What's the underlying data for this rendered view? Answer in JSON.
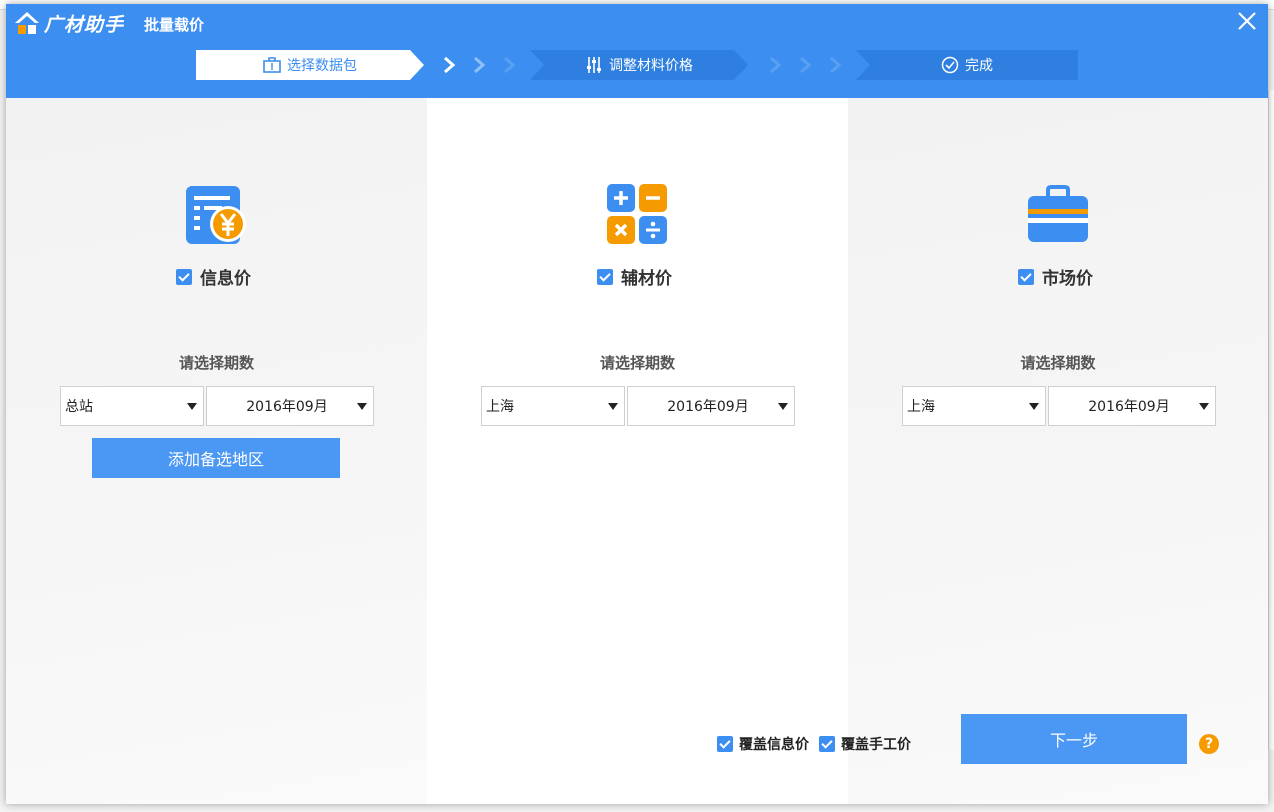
{
  "window": {
    "logo_text": "广材助手",
    "title": "批量载价"
  },
  "steps": [
    {
      "label": "选择数据包",
      "icon": "briefcase-icon",
      "active": true
    },
    {
      "label": "调整材料价格",
      "icon": "sliders-icon",
      "active": false
    },
    {
      "label": "完成",
      "icon": "check-circle-icon",
      "active": false
    }
  ],
  "columns": [
    {
      "name": "信息价",
      "icon": "info-price-icon",
      "checked": true,
      "period_label": "请选择期数",
      "region": "总站",
      "period": "2016年09月",
      "add_region_label": "添加备选地区"
    },
    {
      "name": "辅材价",
      "icon": "calculator-icon",
      "checked": true,
      "period_label": "请选择期数",
      "region": "上海",
      "period": "2016年09月"
    },
    {
      "name": "市场价",
      "icon": "toolbox-icon",
      "checked": true,
      "period_label": "请选择期数",
      "region": "上海",
      "period": "2016年09月"
    }
  ],
  "footer": {
    "cover_info_label": "覆盖信息价",
    "cover_info_checked": true,
    "cover_manual_label": "覆盖手工价",
    "cover_manual_checked": true,
    "next_label": "下一步",
    "help": "?"
  },
  "colors": {
    "accent": "#3c8ef0",
    "button": "#4a97f4",
    "orange": "#f59b00"
  }
}
